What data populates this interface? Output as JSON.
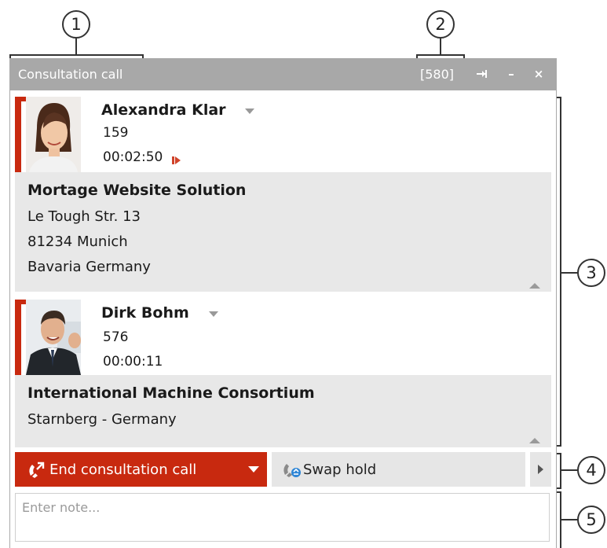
{
  "window": {
    "title": "Consultation call",
    "extension": "[580]",
    "pin_label": "→│",
    "minimize_label": "–",
    "close_label": "×"
  },
  "contacts": [
    {
      "name": "Alexandra Klar",
      "number": "159",
      "duration": "00:02:50",
      "company": "Mortage Website Solution",
      "address": [
        "Le Tough Str. 13",
        "81234 Munich",
        "Bavaria Germany"
      ]
    },
    {
      "name": "Dirk Bohm",
      "number": "576",
      "duration": "00:00:11",
      "company": "International Machine Consortium",
      "address": [
        "Starnberg - Germany"
      ]
    }
  ],
  "actions": {
    "end_label": "End consultation call",
    "swap_label": "Swap hold"
  },
  "note": {
    "placeholder": "Enter note..."
  },
  "callouts": [
    "1",
    "2",
    "3",
    "4",
    "5"
  ],
  "colors": {
    "accent": "#c8290f",
    "titlebar": "#a8a8a8",
    "panel": "#e8e8e8"
  }
}
